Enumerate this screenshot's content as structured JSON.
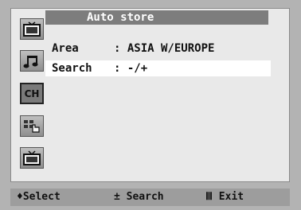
{
  "menu": {
    "title": "Auto store",
    "rows": [
      {
        "label": "Area",
        "value": ": ASIA W/EUROPE"
      },
      {
        "label": "Search",
        "value": ": -/+"
      }
    ],
    "selected_row": "Search"
  },
  "sidebar": {
    "icons": [
      {
        "name": "picture-icon",
        "active": false
      },
      {
        "name": "sound-icon",
        "active": false
      },
      {
        "name": "channel-icon",
        "label": "CH",
        "active": true
      },
      {
        "name": "setup-icon",
        "active": false
      },
      {
        "name": "input-icon",
        "active": false
      }
    ]
  },
  "status": {
    "select_glyph": "♦",
    "select": "Select",
    "search_glyph": "±",
    "search": "Search",
    "exit_glyph": "Ⅲ",
    "exit": "Exit"
  }
}
